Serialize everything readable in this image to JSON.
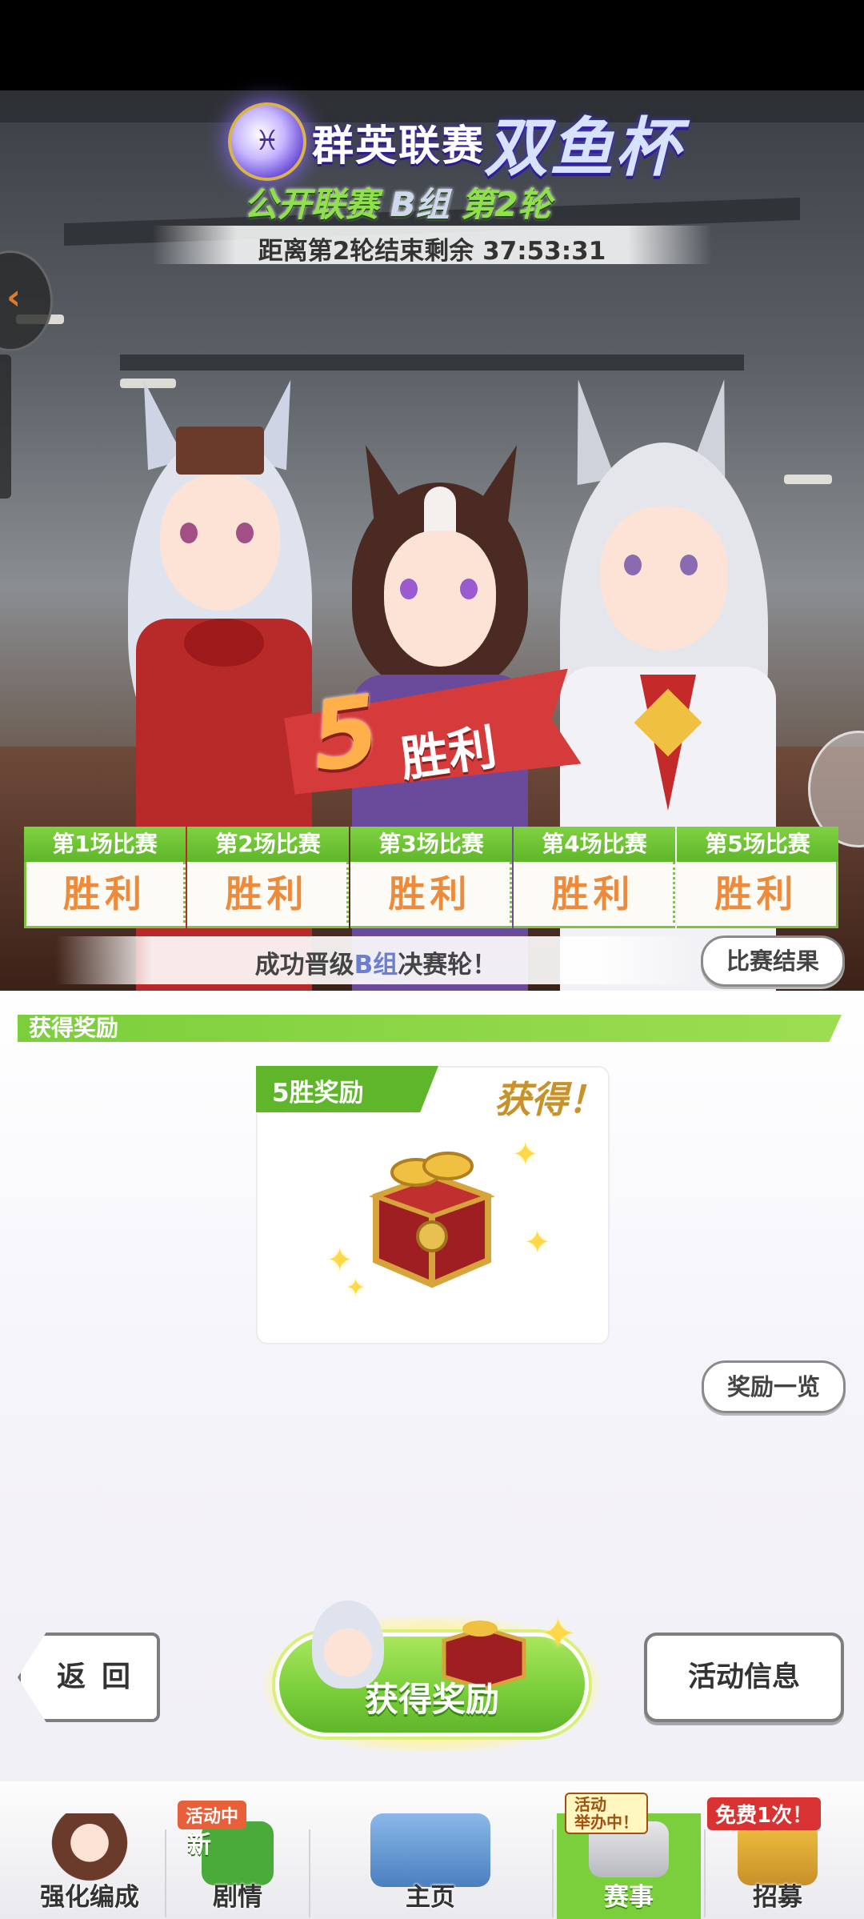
{
  "event": {
    "logo_icon": "pisces-emblem",
    "series": "群英联赛",
    "cup": "双鱼杯",
    "stage_prefix": "公开联赛",
    "group": "B组",
    "round": "第2轮",
    "countdown": "距离第2轮结束剩余 37:53:31"
  },
  "win_banner": {
    "number": "5",
    "text": "胜利"
  },
  "matches": [
    {
      "label": "第1场比赛",
      "result": "胜利"
    },
    {
      "label": "第2场比赛",
      "result": "胜利"
    },
    {
      "label": "第3场比赛",
      "result": "胜利"
    },
    {
      "label": "第4场比赛",
      "result": "胜利"
    },
    {
      "label": "第5场比赛",
      "result": "胜利"
    }
  ],
  "promotion": {
    "pre": "成功晋级",
    "group": "B组",
    "post": "决赛轮！"
  },
  "buttons": {
    "match_results": "比赛结果",
    "reward_list": "奖励一览",
    "back": "返回",
    "activity_info": "活动信息",
    "claim_rewards": "获得奖励"
  },
  "rewards": {
    "header": "获得奖励",
    "tag": "5胜奖励",
    "status": "获得！",
    "item_icon": "treasure-box-with-golden-shoes"
  },
  "nav": {
    "items": [
      {
        "label": "强化编成",
        "icon": "character-icon"
      },
      {
        "label": "剧情",
        "icon": "story-book-icon",
        "badge": "活动中",
        "new": "新"
      },
      {
        "label": "主页",
        "icon": "home-building-icon"
      },
      {
        "label": "赛事",
        "icon": "race-icon",
        "badge": "活动\n举办中！"
      },
      {
        "label": "招募",
        "icon": "gacha-icon",
        "badge": "免费1次！"
      }
    ],
    "active": "赛事"
  },
  "colors": {
    "accent_green": "#7ccf3c",
    "win_orange": "#ef8a3a",
    "banner_red": "#d63b3b"
  }
}
